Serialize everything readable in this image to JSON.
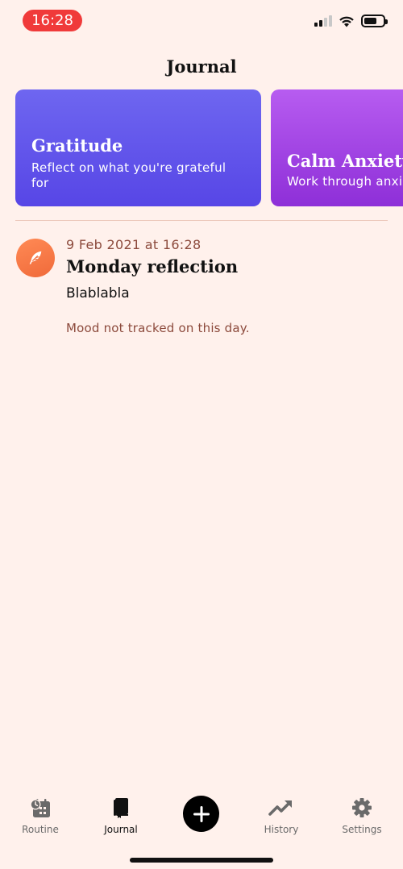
{
  "status_bar": {
    "time": "16:28",
    "icons": [
      "cellular-signal-icon",
      "wifi-icon",
      "battery-icon"
    ],
    "battery_level": 0.7
  },
  "header": {
    "title": "Journal"
  },
  "cards": [
    {
      "title": "Gratitude",
      "subtitle": "Reflect on what you're grateful for",
      "colors": [
        "#6e66f0",
        "#5746e6"
      ]
    },
    {
      "title": "Calm Anxiety",
      "subtitle": "Work through anxiety",
      "colors": [
        "#b75cf0",
        "#8e2fd8"
      ]
    }
  ],
  "entries": [
    {
      "icon": "feather-icon",
      "date": "9 Feb 2021 at 16:28",
      "title": "Monday reflection",
      "body": "Blablabla",
      "mood": "Mood not tracked on this day."
    }
  ],
  "tab_bar": {
    "tabs": [
      {
        "label": "Routine",
        "icon": "routine-calendar-icon",
        "active": false
      },
      {
        "label": "Journal",
        "icon": "journal-book-icon",
        "active": true
      },
      {
        "label": "History",
        "icon": "trending-up-icon",
        "active": false
      },
      {
        "label": "Settings",
        "icon": "gear-icon",
        "active": false
      }
    ],
    "add_icon": "plus-icon"
  },
  "colors": {
    "background": "#fff1ec",
    "accent_text": "#8c4a3c",
    "status_pill": "#f03a3a",
    "entry_icon": "#f06a3a"
  }
}
